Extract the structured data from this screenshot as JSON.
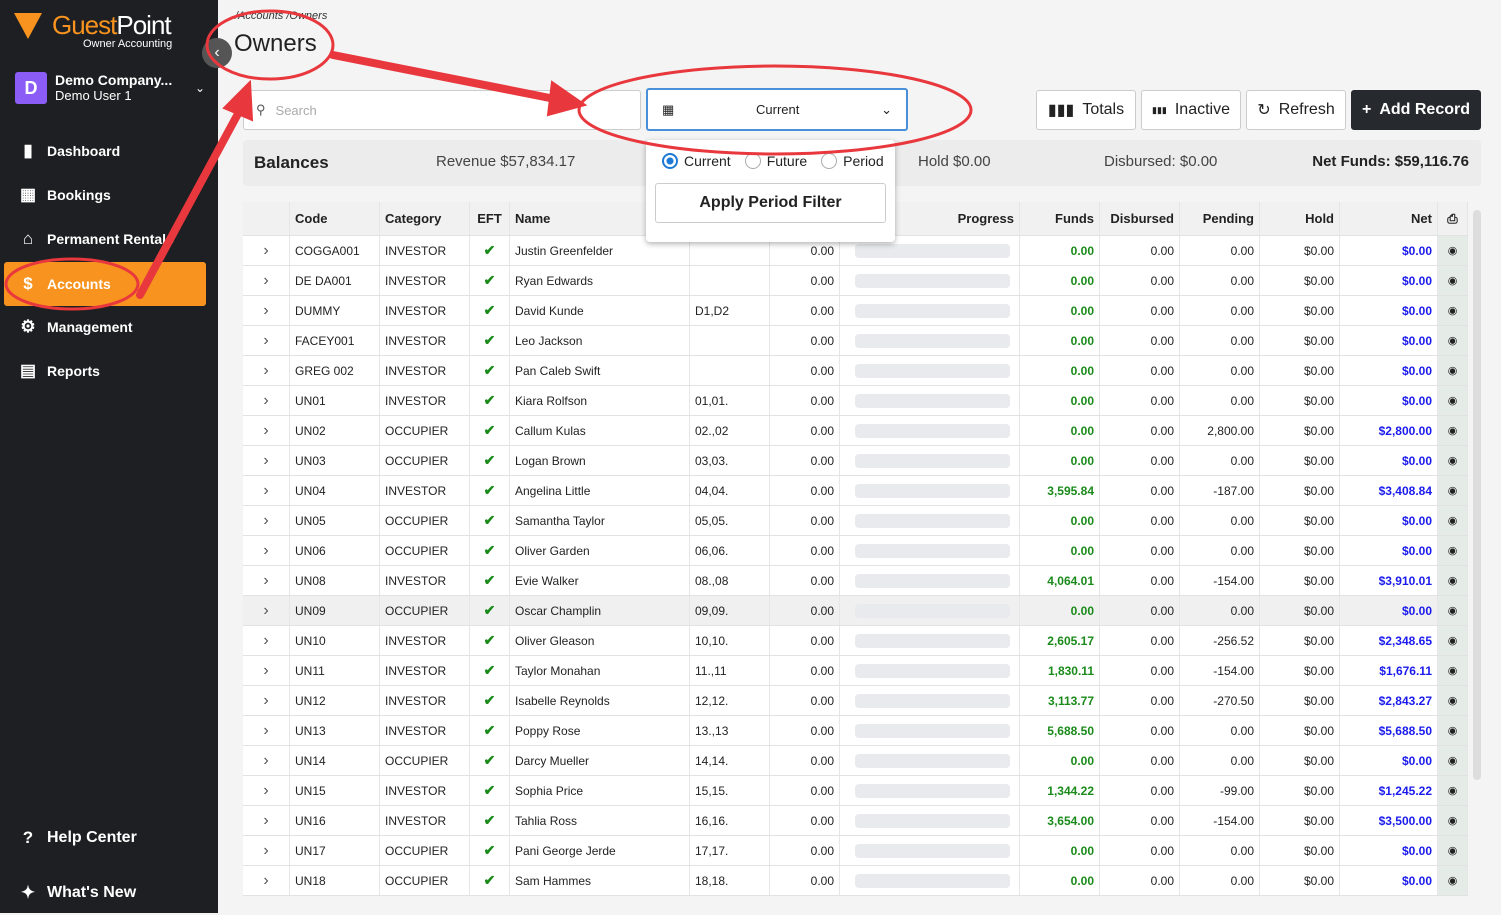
{
  "app": {
    "brand_a": "Guest",
    "brand_b": "Point",
    "subtitle": "Owner Accounting",
    "company": "Demo Company...",
    "user": "Demo User 1",
    "avatar_letter": "D"
  },
  "sidebar": {
    "items": [
      {
        "label": "Dashboard",
        "icon": "bar-chart-icon"
      },
      {
        "label": "Bookings",
        "icon": "calendar-icon"
      },
      {
        "label": "Permanent Rentals",
        "icon": "house-icon"
      },
      {
        "label": "Accounts",
        "icon": "dollar-icon",
        "active": true
      },
      {
        "label": "Management",
        "icon": "users-gear-icon"
      },
      {
        "label": "Reports",
        "icon": "document-icon"
      }
    ],
    "help": "Help Center",
    "whats_new": "What's New"
  },
  "header": {
    "breadcrumb": "/Accounts /Owners",
    "title": "Owners"
  },
  "search": {
    "placeholder": "Search"
  },
  "period_select": {
    "value": "Current"
  },
  "popup": {
    "options": [
      "Current",
      "Future",
      "Period"
    ],
    "selected": "Current",
    "apply": "Apply Period Filter"
  },
  "toolbar": {
    "totals": "Totals",
    "inactive": "Inactive",
    "refresh": "Refresh",
    "add": "Add Record"
  },
  "balances": {
    "label": "Balances",
    "revenue": "Revenue $57,834.17",
    "hold": "Hold $0.00",
    "disbursed": "Disbursed: $0.00",
    "net": "Net Funds: $59,116.76"
  },
  "table": {
    "columns": [
      "",
      "Code",
      "Category",
      "EFT",
      "Name",
      "",
      "",
      "Progress",
      "Funds",
      "Disbursed",
      "Pending",
      "Hold",
      "Net"
    ],
    "rows": [
      [
        "COGGA001",
        "INVESTOR",
        "Justin Greenfelder",
        "",
        "0.00",
        "0.00",
        "0.00",
        "0.00",
        "$0.00",
        "$0.00"
      ],
      [
        "DE DA001",
        "INVESTOR",
        "Ryan Edwards",
        "",
        "0.00",
        "0.00",
        "0.00",
        "0.00",
        "$0.00",
        "$0.00"
      ],
      [
        "DUMMY",
        "INVESTOR",
        "David Kunde",
        "D1,D2",
        "0.00",
        "0.00",
        "0.00",
        "0.00",
        "$0.00",
        "$0.00"
      ],
      [
        "FACEY001",
        "INVESTOR",
        "Leo Jackson",
        "",
        "0.00",
        "0.00",
        "0.00",
        "0.00",
        "$0.00",
        "$0.00"
      ],
      [
        "GREG 002",
        "INVESTOR",
        "Pan Caleb Swift",
        "",
        "0.00",
        "0.00",
        "0.00",
        "0.00",
        "$0.00",
        "$0.00"
      ],
      [
        "UN01",
        "INVESTOR",
        "Kiara Rolfson",
        "01,01.",
        "0.00",
        "0.00",
        "0.00",
        "0.00",
        "$0.00",
        "$0.00"
      ],
      [
        "UN02",
        "OCCUPIER",
        "Callum Kulas",
        "02.,02",
        "0.00",
        "0.00",
        "0.00",
        "2,800.00",
        "$0.00",
        "$2,800.00"
      ],
      [
        "UN03",
        "OCCUPIER",
        "Logan Brown",
        "03,03.",
        "0.00",
        "0.00",
        "0.00",
        "0.00",
        "$0.00",
        "$0.00"
      ],
      [
        "UN04",
        "INVESTOR",
        "Angelina Little",
        "04,04.",
        "0.00",
        "3,595.84",
        "0.00",
        "-187.00",
        "$0.00",
        "$3,408.84"
      ],
      [
        "UN05",
        "OCCUPIER",
        "Samantha Taylor",
        "05,05.",
        "0.00",
        "0.00",
        "0.00",
        "0.00",
        "$0.00",
        "$0.00"
      ],
      [
        "UN06",
        "OCCUPIER",
        "Oliver Garden",
        "06,06.",
        "0.00",
        "0.00",
        "0.00",
        "0.00",
        "$0.00",
        "$0.00"
      ],
      [
        "UN08",
        "INVESTOR",
        "Evie Walker",
        "08.,08",
        "0.00",
        "4,064.01",
        "0.00",
        "-154.00",
        "$0.00",
        "$3,910.01"
      ],
      [
        "UN09",
        "OCCUPIER",
        "Oscar Champlin",
        "09,09.",
        "0.00",
        "0.00",
        "0.00",
        "0.00",
        "$0.00",
        "$0.00"
      ],
      [
        "UN10",
        "INVESTOR",
        "Oliver Gleason",
        "10,10.",
        "0.00",
        "2,605.17",
        "0.00",
        "-256.52",
        "$0.00",
        "$2,348.65"
      ],
      [
        "UN11",
        "INVESTOR",
        "Taylor Monahan",
        "11.,11",
        "0.00",
        "1,830.11",
        "0.00",
        "-154.00",
        "$0.00",
        "$1,676.11"
      ],
      [
        "UN12",
        "INVESTOR",
        "Isabelle Reynolds",
        "12,12.",
        "0.00",
        "3,113.77",
        "0.00",
        "-270.50",
        "$0.00",
        "$2,843.27"
      ],
      [
        "UN13",
        "INVESTOR",
        "Poppy Rose",
        "13.,13",
        "0.00",
        "5,688.50",
        "0.00",
        "0.00",
        "$0.00",
        "$5,688.50"
      ],
      [
        "UN14",
        "OCCUPIER",
        "Darcy Mueller",
        "14,14.",
        "0.00",
        "0.00",
        "0.00",
        "0.00",
        "$0.00",
        "$0.00"
      ],
      [
        "UN15",
        "INVESTOR",
        "Sophia Price",
        "15,15.",
        "0.00",
        "1,344.22",
        "0.00",
        "-99.00",
        "$0.00",
        "$1,245.22"
      ],
      [
        "UN16",
        "INVESTOR",
        "Tahlia Ross",
        "16,16.",
        "0.00",
        "3,654.00",
        "0.00",
        "-154.00",
        "$0.00",
        "$3,500.00"
      ],
      [
        "UN17",
        "OCCUPIER",
        "Pani George Jerde",
        "17,17.",
        "0.00",
        "0.00",
        "0.00",
        "0.00",
        "$0.00",
        "$0.00"
      ],
      [
        "UN18",
        "OCCUPIER",
        "Sam Hammes",
        "18,18.",
        "0.00",
        "0.00",
        "0.00",
        "0.00",
        "$0.00",
        "$0.00"
      ]
    ]
  },
  "colors": {
    "accent": "#f7931e",
    "funds": "#1a8a1a",
    "net": "#1a1aee",
    "annotation": "#e8383d"
  }
}
